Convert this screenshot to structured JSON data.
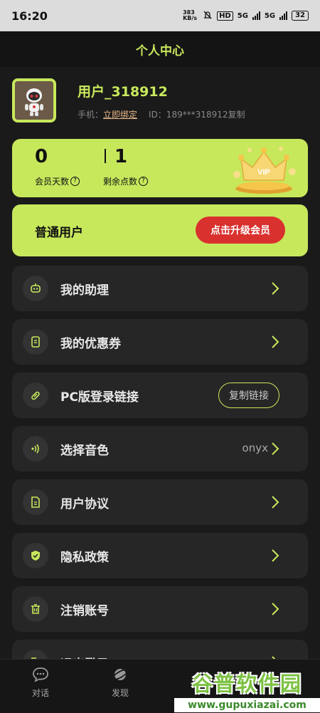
{
  "statusbar": {
    "time": "16:20",
    "net_speed": "383 KB/s",
    "hd": "HD",
    "sig1": "5G",
    "sig2": "5G",
    "battery": "32"
  },
  "header": {
    "title": "个人中心"
  },
  "profile": {
    "username": "用户_318912",
    "phone_label": "手机：",
    "phone_action": "立即绑定",
    "id_text": "ID：189***318912复制"
  },
  "vip_card": {
    "member_days_value": "0",
    "points_value": "1",
    "member_days_label": "会员天数",
    "points_label": "剩余点数",
    "help_glyph": "?",
    "badge_text": "VIP"
  },
  "member_card": {
    "level": "普通用户",
    "upgrade_label": "点击升级会员"
  },
  "menu": [
    {
      "label": "我的助理",
      "icon": "robot-icon"
    },
    {
      "label": "我的优惠券",
      "icon": "coupon-icon"
    },
    {
      "label": "PC版登录链接",
      "icon": "link-icon",
      "button": "复制链接"
    },
    {
      "label": "选择音色",
      "icon": "voice-icon",
      "value": "onyx"
    },
    {
      "label": "用户协议",
      "icon": "document-icon"
    },
    {
      "label": "隐私政策",
      "icon": "shield-icon"
    },
    {
      "label": "注销账号",
      "icon": "trash-icon"
    },
    {
      "label": "退出登录",
      "icon": "logout-icon"
    }
  ],
  "tabs": [
    {
      "label": "对话",
      "icon": "chat-icon"
    },
    {
      "label": "发现",
      "icon": "planet-icon"
    }
  ],
  "watermark": {
    "title": "谷普软件园",
    "url": "www.gupuxiazai.com"
  },
  "colors": {
    "accent": "#c8e85c",
    "danger": "#d9312e",
    "background": "#1a1a1a",
    "card": "#262626"
  }
}
